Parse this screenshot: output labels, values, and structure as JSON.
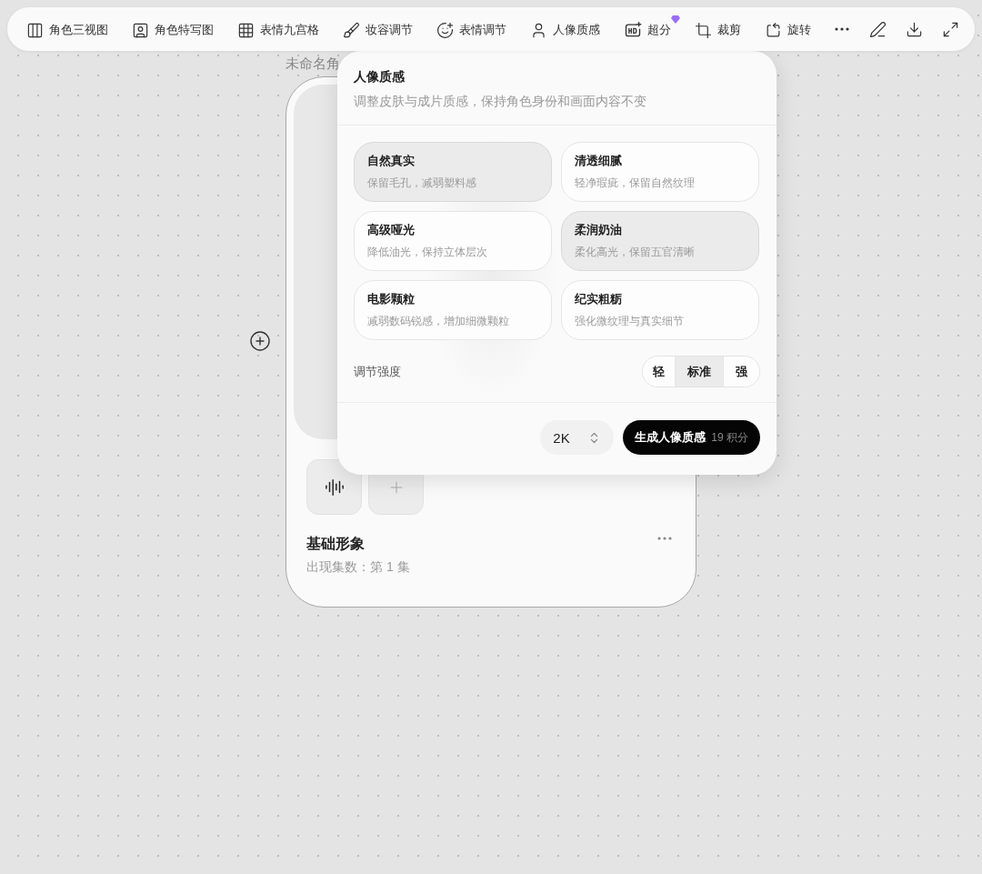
{
  "toolbar": {
    "items": [
      {
        "label": "角色三视图",
        "premium": false
      },
      {
        "label": "角色特写图",
        "premium": false
      },
      {
        "label": "表情九宫格",
        "premium": false
      },
      {
        "label": "妆容调节",
        "premium": false
      },
      {
        "label": "表情调节",
        "premium": false
      },
      {
        "label": "人像质感",
        "premium": false
      },
      {
        "label": "超分",
        "premium": true
      },
      {
        "label": "裁剪",
        "premium": false
      },
      {
        "label": "旋转",
        "premium": false
      }
    ]
  },
  "card": {
    "name_label": "未命名角",
    "title": "基础形象",
    "subtitle": "出现集数：第 1 集"
  },
  "popover": {
    "title": "人像质感",
    "description": "调整皮肤与成片质感，保持角色身份和画面内容不变",
    "options": [
      {
        "title": "自然真实",
        "desc": "保留毛孔，减弱塑料感",
        "selected": true
      },
      {
        "title": "清透细腻",
        "desc": "轻净瑕疵，保留自然纹理",
        "selected": false
      },
      {
        "title": "高级哑光",
        "desc": "降低油光，保持立体层次",
        "selected": false
      },
      {
        "title": "柔润奶油",
        "desc": "柔化高光，保留五官清晰",
        "selected": true
      },
      {
        "title": "电影颗粒",
        "desc": "减弱数码锐感，增加细微颗粒",
        "selected": false
      },
      {
        "title": "纪实粗粝",
        "desc": "强化微纹理与真实细节",
        "selected": false
      }
    ],
    "intensity": {
      "label": "调节强度",
      "levels": [
        {
          "label": "轻",
          "selected": false
        },
        {
          "label": "标准",
          "selected": true
        },
        {
          "label": "强",
          "selected": false
        }
      ]
    },
    "resolution": "2K",
    "generate": {
      "label": "生成人像质感",
      "cost": "19 积分"
    }
  }
}
